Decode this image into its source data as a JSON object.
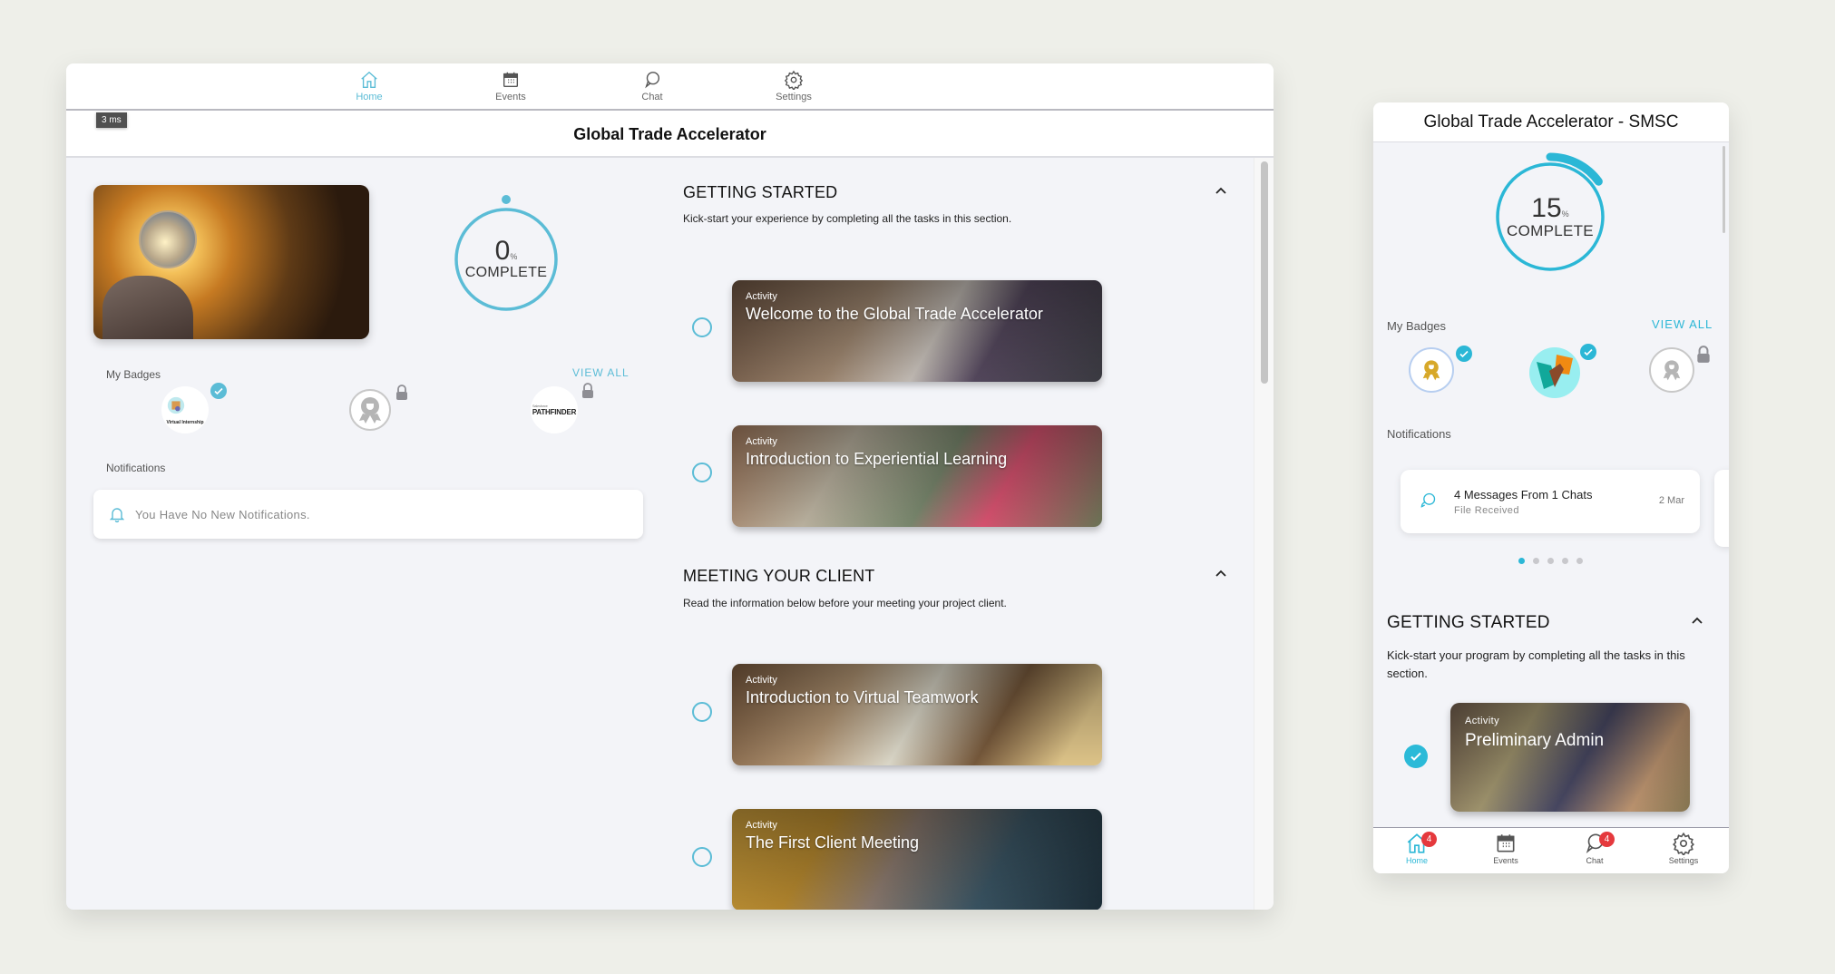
{
  "wide": {
    "nav": [
      {
        "label": "Home",
        "icon": "home-icon",
        "active": true
      },
      {
        "label": "Events",
        "icon": "calendar-icon",
        "active": false
      },
      {
        "label": "Chat",
        "icon": "chat-icon",
        "active": false
      },
      {
        "label": "Settings",
        "icon": "gear-icon",
        "active": false
      }
    ],
    "timing_badge": "3 ms",
    "title": "Global Trade Accelerator",
    "progress": {
      "value": 0,
      "unit": "%",
      "label": "COMPLETE",
      "fraction": 0.0
    },
    "badges_label": "My Badges",
    "view_all": "VIEW ALL",
    "badges": [
      {
        "name": "Virtual Internship",
        "status": "earned"
      },
      {
        "name": "Award ribbon",
        "status": "locked"
      },
      {
        "name": "Salesforce PATHFINDER",
        "brand": "Salesforce",
        "title": "PATHFINDER",
        "status": "locked"
      }
    ],
    "notifications_label": "Notifications",
    "notifications_empty": "You Have No New Notifications.",
    "sections": [
      {
        "title": "GETTING STARTED",
        "description": "Kick-start your experience by completing all the tasks in this section.",
        "tasks": [
          {
            "tag": "Activity",
            "title": "Welcome to the Global Trade Accelerator",
            "completed": false
          },
          {
            "tag": "Activity",
            "title": "Introduction to Experiential Learning",
            "completed": false
          }
        ]
      },
      {
        "title": "MEETING YOUR CLIENT",
        "description": "Read the information below before your meeting your project client.",
        "tasks": [
          {
            "tag": "Activity",
            "title": "Introduction to Virtual Teamwork",
            "completed": false
          },
          {
            "tag": "Activity",
            "title": "The First Client Meeting",
            "completed": false
          }
        ]
      }
    ]
  },
  "mobile": {
    "title": "Global Trade Accelerator - SMSC",
    "progress": {
      "value": 15,
      "unit": "%",
      "label": "COMPLETE",
      "fraction": 0.15
    },
    "badges_label": "My Badges",
    "view_all": "VIEW ALL",
    "badges": [
      {
        "name": "Gold award ribbon",
        "status": "earned"
      },
      {
        "name": "Teamwork hands",
        "status": "earned"
      },
      {
        "name": "Award ribbon",
        "status": "locked"
      }
    ],
    "notifications_label": "Notifications",
    "notification": {
      "title": "4 Messages From 1 Chats",
      "subtitle": "File Received",
      "date": "2 Mar"
    },
    "carousel": {
      "pages": 5,
      "active": 1
    },
    "section": {
      "title": "GETTING STARTED",
      "description": "Kick-start your program by completing all the tasks in this section.",
      "task": {
        "tag": "Activity",
        "title": "Preliminary Admin",
        "completed": true
      }
    },
    "tabs": [
      {
        "label": "Home",
        "icon": "home-icon",
        "active": true,
        "badge": "4"
      },
      {
        "label": "Events",
        "icon": "calendar-icon",
        "active": false
      },
      {
        "label": "Chat",
        "icon": "chat-icon",
        "active": false,
        "badge": "4"
      },
      {
        "label": "Settings",
        "icon": "gear-icon",
        "active": false
      }
    ]
  },
  "colors": {
    "accent": "#5bbcd6",
    "accent_mobile": "#2bb7d6",
    "badge_red": "#e5393d",
    "lock_gray": "#8e8e94"
  }
}
